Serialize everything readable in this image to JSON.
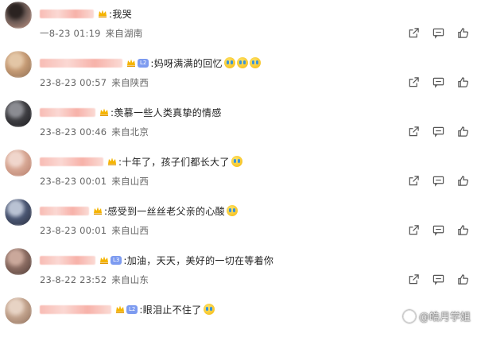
{
  "comments": [
    {
      "text": ":我哭",
      "date": "一8-23 01:19",
      "location": "来自湖南",
      "level": "",
      "emoji_count": 0,
      "avatar": [
        "#6b5a55",
        "#2b2321",
        "#c79887"
      ]
    },
    {
      "text": ":妈呀满满的回忆",
      "date": "23-8-23 00:57",
      "location": "来自陕西",
      "level": "L2",
      "emoji_count": 3,
      "avatar": [
        "#c59a74",
        "#e3c6a6",
        "#8c6f55"
      ]
    },
    {
      "text": ":羡慕一些人类真挚的情感",
      "date": "23-8-23 00:46",
      "location": "来自北京",
      "level": "",
      "emoji_count": 0,
      "avatar": [
        "#3e3e42",
        "#8b8c92",
        "#1c1c20"
      ]
    },
    {
      "text": ":十年了，孩子们都长大了",
      "date": "23-8-23 00:01",
      "location": "来自山西",
      "level": "",
      "emoji_count": 1,
      "avatar": [
        "#d7a794",
        "#f0d6cc",
        "#b47c6a"
      ]
    },
    {
      "text": ":感受到一丝丝老父亲的心酸",
      "date": "23-8-23 00:01",
      "location": "来自山西",
      "level": "",
      "emoji_count": 1,
      "avatar": [
        "#4a5673",
        "#b9c2d3",
        "#2a2f3d"
      ]
    },
    {
      "text": ":加油，天天，美好的一切在等着你",
      "date": "23-8-22 23:52",
      "location": "来自山东",
      "level": "L3",
      "emoji_count": 0,
      "avatar": [
        "#8b6c62",
        "#caa89b",
        "#4e3b36"
      ]
    },
    {
      "text": ":眼泪止不住了",
      "date": "",
      "location": "",
      "level": "L2",
      "emoji_count": 1,
      "avatar": [
        "#c2a38d",
        "#e7d3c4",
        "#8d6d5a"
      ]
    }
  ],
  "watermark": "@皓月学姐",
  "colors": {
    "level_badge": "#7d9bf0",
    "crown": "#f5b400",
    "meta_text": "#666666"
  }
}
